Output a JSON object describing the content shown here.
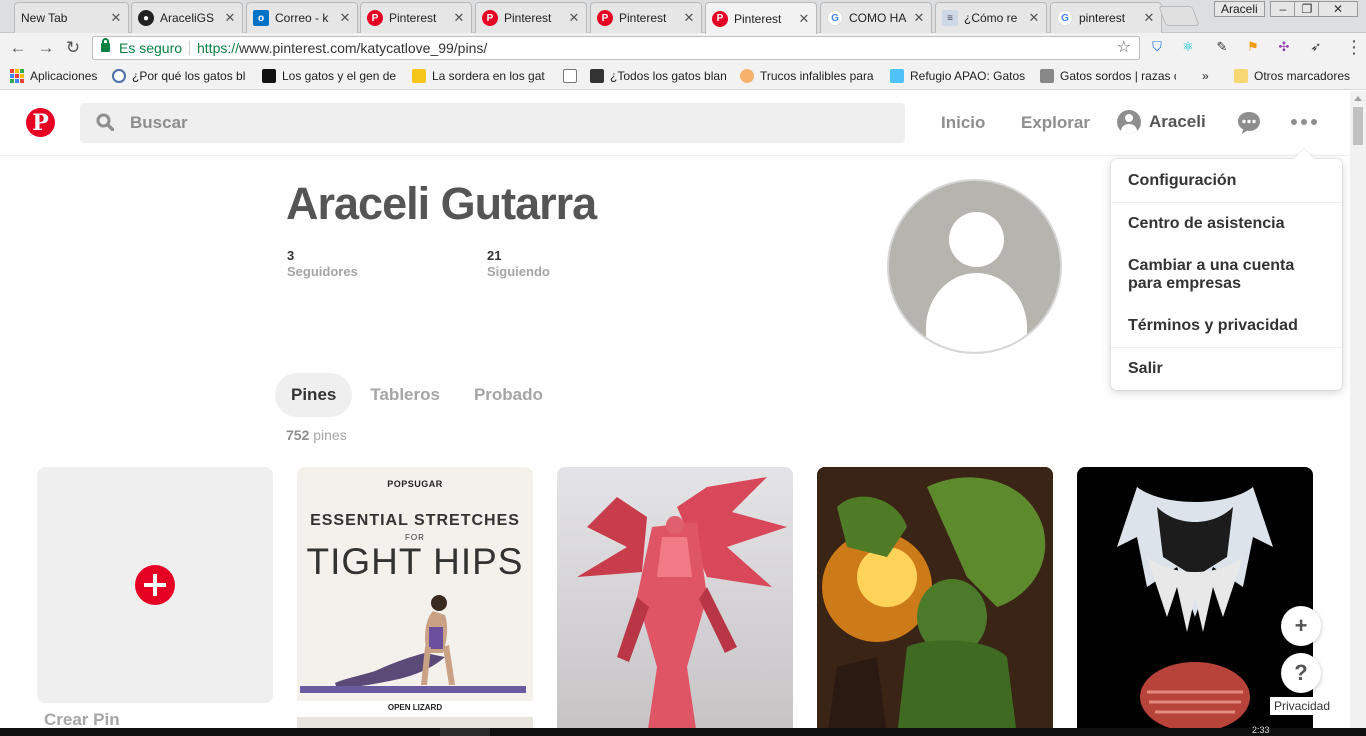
{
  "browser": {
    "tabs": [
      {
        "label": "New Tab",
        "icon": "none",
        "active": false
      },
      {
        "label": "AraceliGS",
        "icon": "github-icon",
        "active": false
      },
      {
        "label": "Correo - k",
        "icon": "outlook-icon",
        "active": false
      },
      {
        "label": "Pinterest",
        "icon": "pinterest-icon",
        "active": false
      },
      {
        "label": "Pinterest",
        "icon": "pinterest-icon",
        "active": false
      },
      {
        "label": "Pinterest",
        "icon": "pinterest-icon",
        "active": false
      },
      {
        "label": "Pinterest",
        "icon": "pinterest-icon",
        "active": true
      },
      {
        "label": "COMO HA",
        "icon": "google-icon",
        "active": false
      },
      {
        "label": "¿Cómo re",
        "icon": "document-icon",
        "active": false
      },
      {
        "label": "pinterest",
        "icon": "google-icon",
        "active": false
      }
    ],
    "profile_button": "Araceli",
    "secure_label": "Es seguro",
    "url_scheme": "https://",
    "url_rest": "www.pinterest.com/katycatlove_99/pins/",
    "bookmarks": [
      {
        "label": "Aplicaciones"
      },
      {
        "label": "¿Por qué los gatos bl"
      },
      {
        "label": "Los gatos y el gen de"
      },
      {
        "label": "La sordera en los gat"
      },
      {
        "label": ""
      },
      {
        "label": "¿Todos los gatos blan"
      },
      {
        "label": "Trucos infalibles para"
      },
      {
        "label": "Refugio APAO: Gatos"
      },
      {
        "label": "Gatos sordos | razas c"
      },
      {
        "label": "»"
      },
      {
        "label": "Otros marcadores"
      }
    ]
  },
  "header": {
    "logo": "P",
    "search_placeholder": "Buscar",
    "nav_home": "Inicio",
    "nav_explore": "Explorar",
    "user_name": "Araceli"
  },
  "profile": {
    "name": "Araceli Gutarra",
    "followers_count": "3",
    "followers_label": "Seguidores",
    "following_count": "21",
    "following_label": "Siguiendo",
    "tabs": [
      "Pines",
      "Tableros",
      "Probado"
    ],
    "pin_count": "752",
    "pin_count_label": "pines"
  },
  "grid": {
    "create_label": "Crear Pin",
    "pin1": {
      "brand": "POPSUGAR",
      "line1": "ESSENTIAL STRETCHES",
      "line2": "FOR",
      "line3": "TIGHT HIPS",
      "caption": "OPEN LIZARD"
    }
  },
  "menu": {
    "items": [
      "Configuración",
      "Centro de asistencia",
      "Cambiar a una cuenta para empresas",
      "Términos y privacidad",
      "Salir"
    ]
  },
  "floating": {
    "add": "+",
    "help": "?",
    "privacy": "Privacidad"
  },
  "taskbar": {
    "clock": "2:33"
  },
  "colors": {
    "pinterest_red": "#e60023",
    "text_gray": "#8e8e8e",
    "secure_green": "#0b8043"
  }
}
